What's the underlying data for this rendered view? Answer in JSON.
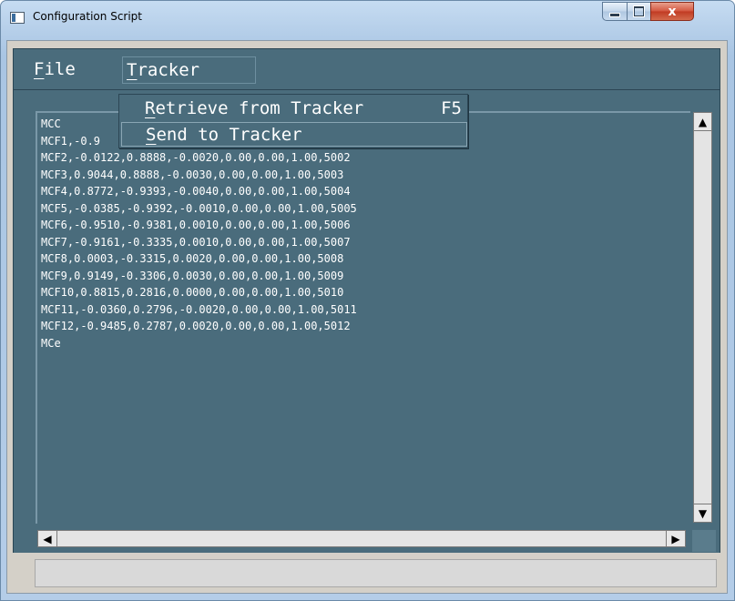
{
  "window": {
    "title": "Configuration Script",
    "controls": {
      "minimize": "–",
      "maximize": "□",
      "close": "x"
    }
  },
  "menubar": {
    "file_first": "F",
    "file_rest": "ile",
    "tracker_first": "T",
    "tracker_rest": "racker"
  },
  "dropdown": {
    "items": [
      {
        "first": "R",
        "rest": "etrieve from Tracker",
        "shortcut": "F5"
      },
      {
        "first": "S",
        "rest": "end to Tracker",
        "shortcut": ""
      }
    ]
  },
  "script": {
    "lines": [
      "MCC",
      "MCF1,-0.9",
      "MCF2,-0.0122,0.8888,-0.0020,0.00,0.00,1.00,5002",
      "MCF3,0.9044,0.8888,-0.0030,0.00,0.00,1.00,5003",
      "MCF4,0.8772,-0.9393,-0.0040,0.00,0.00,1.00,5004",
      "MCF5,-0.0385,-0.9392,-0.0010,0.00,0.00,1.00,5005",
      "MCF6,-0.9510,-0.9381,0.0010,0.00,0.00,1.00,5006",
      "MCF7,-0.9161,-0.3335,0.0010,0.00,0.00,1.00,5007",
      "MCF8,0.0003,-0.3315,0.0020,0.00,0.00,1.00,5008",
      "MCF9,0.9149,-0.3306,0.0030,0.00,0.00,1.00,5009",
      "MCF10,0.8815,0.2816,0.0000,0.00,0.00,1.00,5010",
      "MCF11,-0.0360,0.2796,-0.0020,0.00,0.00,1.00,5011",
      "MCF12,-0.9485,0.2787,0.0020,0.00,0.00,1.00,5012",
      "MCe"
    ]
  },
  "scrollbars": {
    "up": "▲",
    "down": "▼",
    "left": "◀",
    "right": "▶"
  },
  "statusbar": {
    "text": ""
  }
}
